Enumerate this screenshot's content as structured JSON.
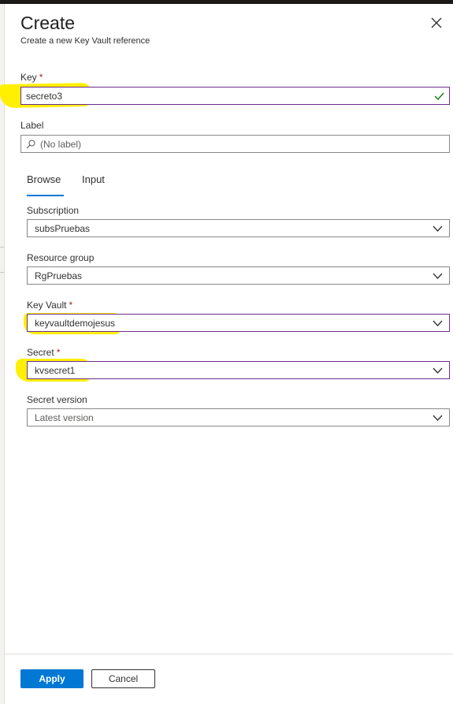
{
  "header": {
    "title": "Create",
    "subtitle": "Create a new Key Vault reference"
  },
  "form": {
    "key": {
      "label": "Key",
      "required_mark": "*",
      "value": "secreto3"
    },
    "label_field": {
      "label": "Label",
      "placeholder": "(No label)"
    },
    "tabs": [
      {
        "label": "Browse",
        "selected": true
      },
      {
        "label": "Input",
        "selected": false
      }
    ],
    "subscription": {
      "label": "Subscription",
      "value": "subsPruebas"
    },
    "resource_group": {
      "label": "Resource group",
      "value": "RgPruebas"
    },
    "key_vault": {
      "label": "Key Vault",
      "required_mark": "*",
      "value": "keyvaultdemojesus"
    },
    "secret": {
      "label": "Secret",
      "required_mark": "*",
      "value": "kvsecret1"
    },
    "secret_version": {
      "label": "Secret version",
      "value": "Latest version"
    }
  },
  "footer": {
    "apply_label": "Apply",
    "cancel_label": "Cancel"
  },
  "colors": {
    "accent": "#0078d4",
    "highlight": "#ffef00",
    "required": "#a4262c",
    "valid": "#107c10",
    "focus_border": "#6b2d8f"
  },
  "icons": {
    "close": "close-icon",
    "search": "search-icon",
    "valid": "checkmark-icon",
    "dropdown": "chevron-down-icon"
  }
}
